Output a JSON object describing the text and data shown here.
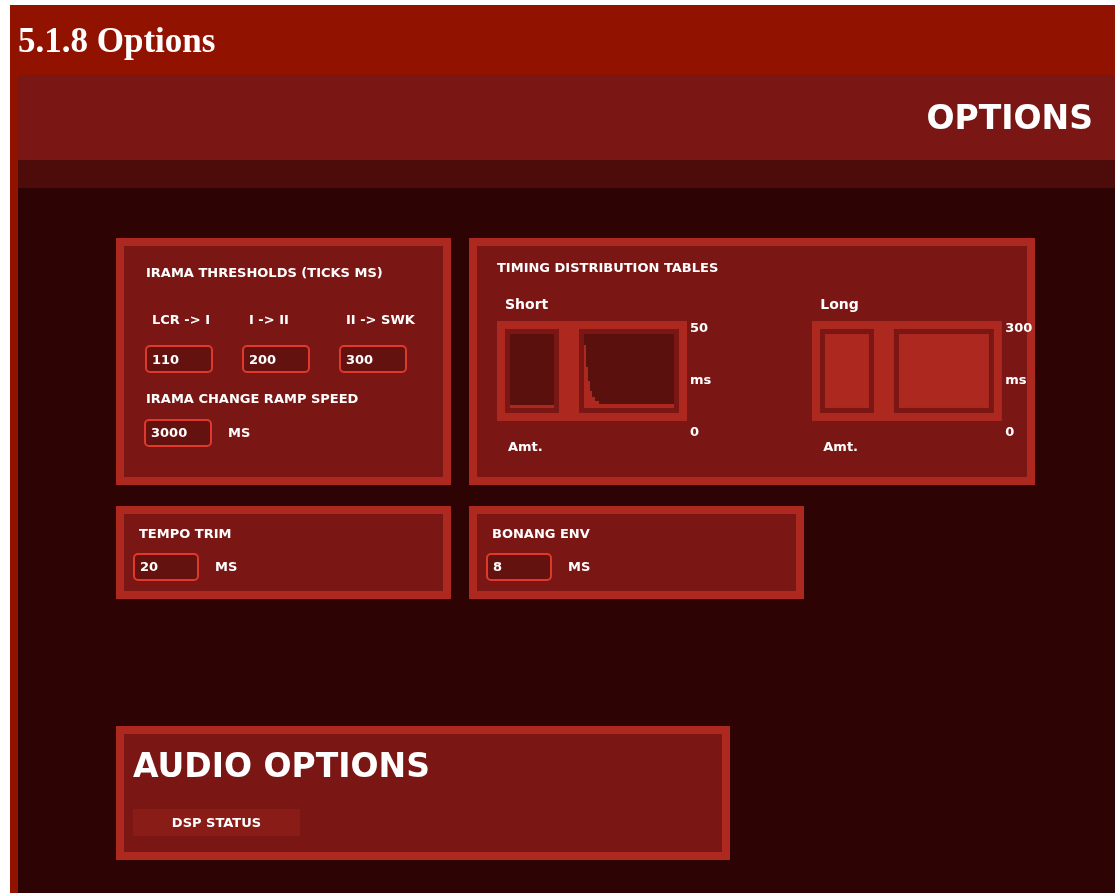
{
  "document_heading": "5.1.8 Options",
  "header": {
    "title": "OPTIONS"
  },
  "irama": {
    "title": "IRAMA THRESHOLDS (TICKS MS)",
    "thresholds": [
      {
        "label": "LCR -> I",
        "value": "110"
      },
      {
        "label": "I -> II",
        "value": "200"
      },
      {
        "label": "II -> SWK",
        "value": "300"
      }
    ],
    "ramp": {
      "label": "IRAMA CHANGE RAMP SPEED",
      "value": "3000",
      "unit": "MS"
    }
  },
  "timing": {
    "title": "TIMING DISTRIBUTION TABLES",
    "tables": [
      {
        "label": "Short",
        "kind": "decay",
        "max": "50",
        "unit": "ms",
        "min": "0",
        "axis_label": "Amt."
      },
      {
        "label": "Long",
        "kind": "full",
        "max": "300",
        "unit": "ms",
        "min": "0",
        "axis_label": "Amt."
      }
    ]
  },
  "tempo_trim": {
    "title": "TEMPO TRIM",
    "value": "20",
    "unit": "MS"
  },
  "bonang_env": {
    "title": "BONANG ENV",
    "value": "8",
    "unit": "MS"
  },
  "audio": {
    "title": "AUDIO OPTIONS",
    "buttons": [
      "DSP STATUS"
    ]
  }
}
